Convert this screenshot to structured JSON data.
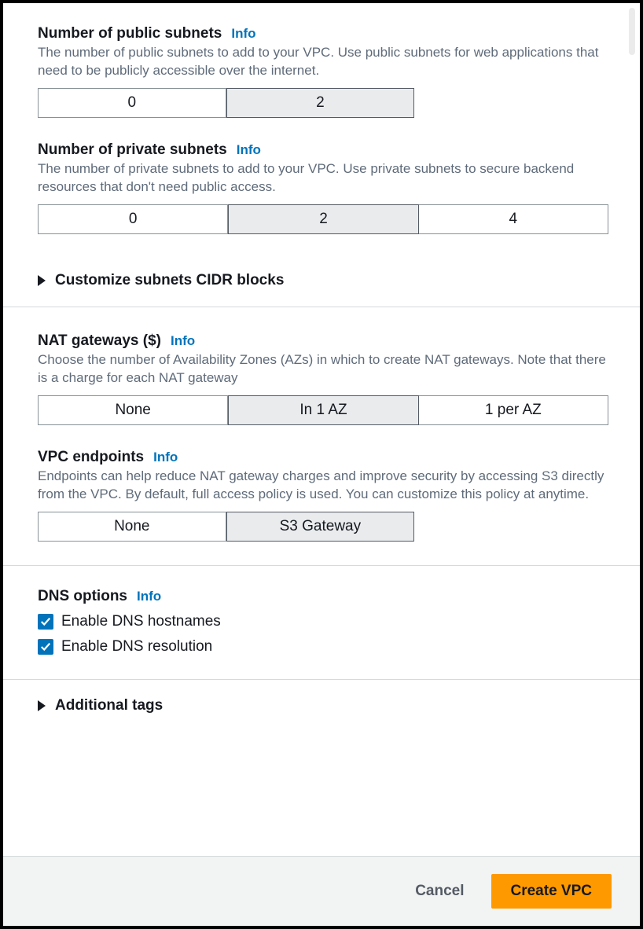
{
  "info": "Info",
  "publicSubnets": {
    "label": "Number of public subnets",
    "description": "The number of public subnets to add to your VPC. Use public subnets for web applications that need to be publicly accessible over the internet.",
    "options": [
      "0",
      "2"
    ],
    "selectedIndex": 1
  },
  "privateSubnets": {
    "label": "Number of private subnets",
    "description": "The number of private subnets to add to your VPC. Use private subnets to secure backend resources that don't need public access.",
    "options": [
      "0",
      "2",
      "4"
    ],
    "selectedIndex": 1
  },
  "customizeCidr": {
    "label": "Customize subnets CIDR blocks"
  },
  "natGateways": {
    "label": "NAT gateways ($)",
    "description": "Choose the number of Availability Zones (AZs) in which to create NAT gateways. Note that there is a charge for each NAT gateway",
    "options": [
      "None",
      "In 1 AZ",
      "1 per AZ"
    ],
    "selectedIndex": 1
  },
  "vpcEndpoints": {
    "label": "VPC endpoints",
    "description": "Endpoints can help reduce NAT gateway charges and improve security by accessing S3 directly from the VPC. By default, full access policy is used. You can customize this policy at anytime.",
    "options": [
      "None",
      "S3 Gateway"
    ],
    "selectedIndex": 1
  },
  "dnsOptions": {
    "label": "DNS options",
    "hostnames": {
      "label": "Enable DNS hostnames",
      "checked": true
    },
    "resolution": {
      "label": "Enable DNS resolution",
      "checked": true
    }
  },
  "additionalTags": {
    "label": "Additional tags"
  },
  "footer": {
    "cancel": "Cancel",
    "create": "Create VPC"
  }
}
